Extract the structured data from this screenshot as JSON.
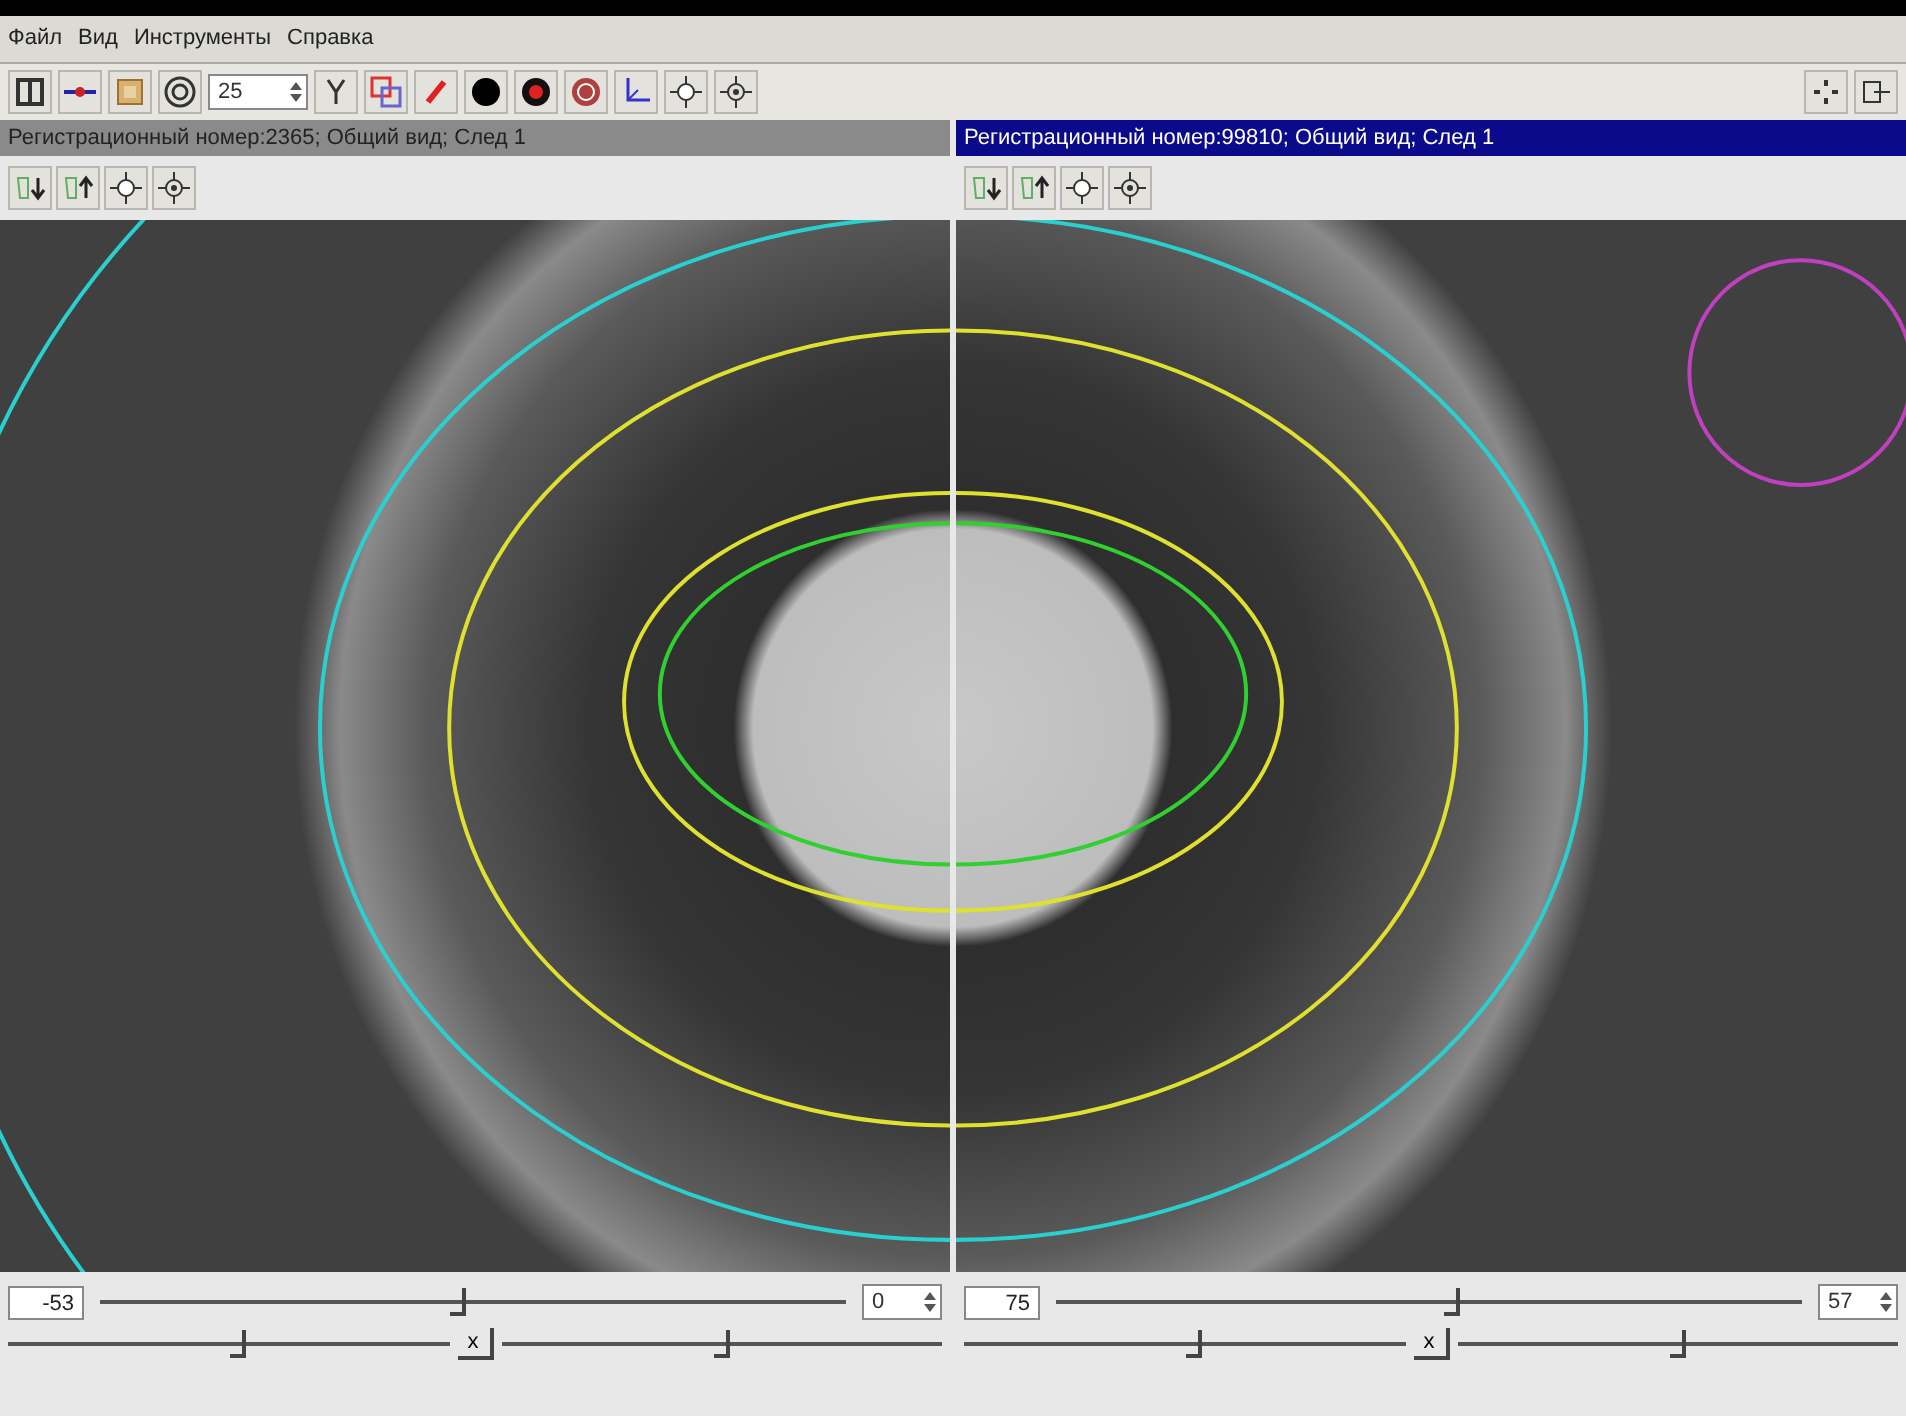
{
  "menu": [
    {
      "label": "Файл"
    },
    {
      "label": "Вид"
    },
    {
      "label": "Инструменты"
    },
    {
      "label": "Справка"
    }
  ],
  "toolbar": {
    "spin_value": "25"
  },
  "panels": [
    {
      "title": "Регистрационный номер:2365; Общий вид; След 1",
      "selected": false,
      "offset_value": "-53",
      "main_slider": {
        "level": 0.48
      },
      "spin_value": "0",
      "lower_sliders": [
        {
          "level": 0.52
        },
        {
          "level": 0.5
        }
      ],
      "reset_label": "x"
    },
    {
      "title": "Регистрационный номер:99810; Общий вид; След 1",
      "selected": true,
      "offset_value": "75",
      "main_slider": {
        "level": 0.53
      },
      "spin_value": "57",
      "lower_sliders": [
        {
          "level": 0.52
        },
        {
          "level": 0.5
        }
      ],
      "reset_label": "x"
    }
  ]
}
